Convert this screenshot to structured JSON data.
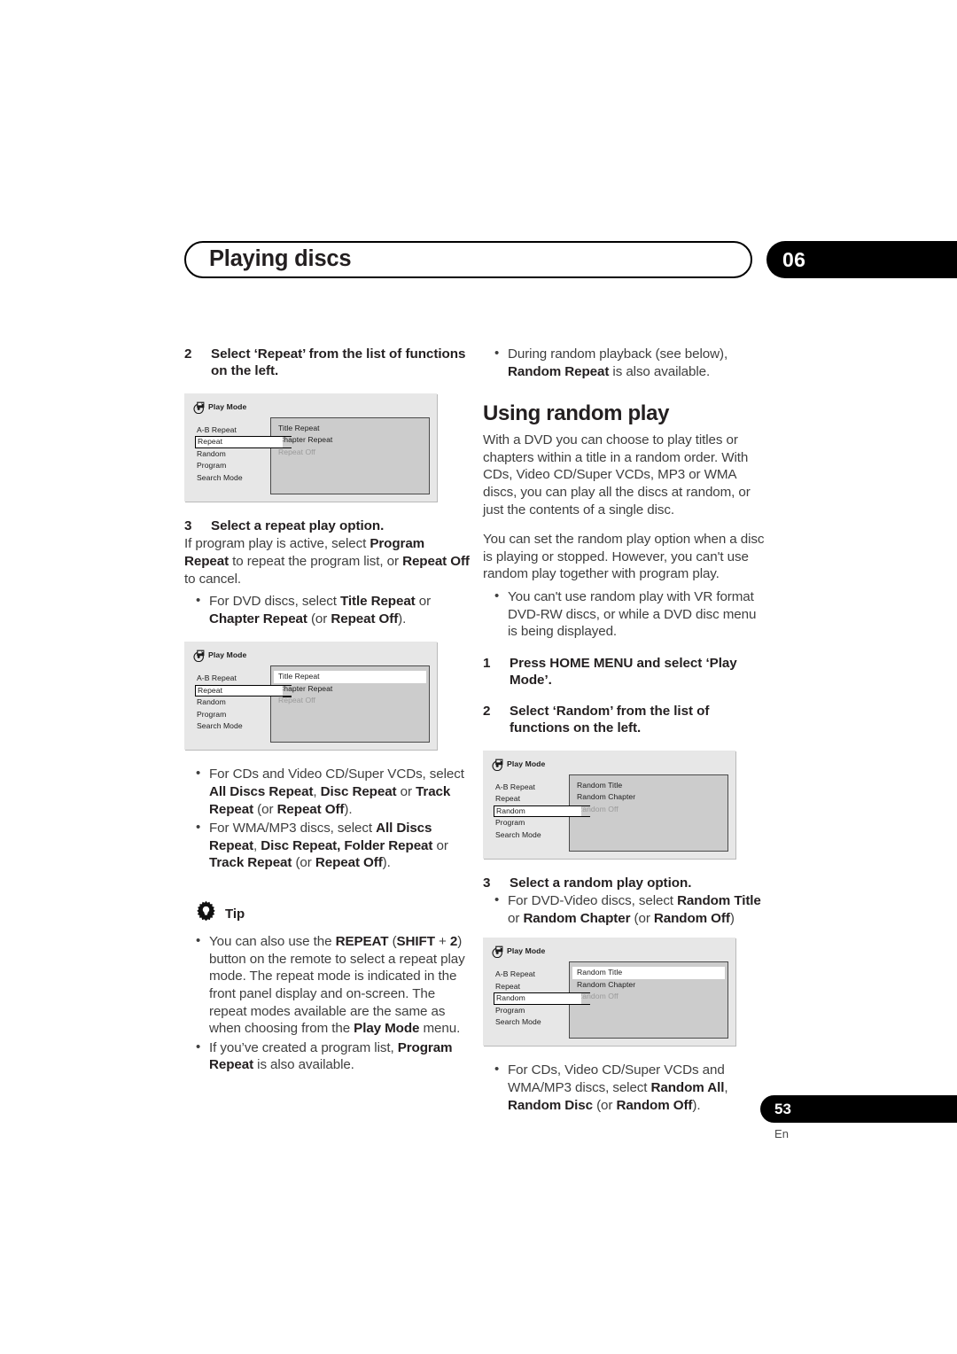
{
  "header": {
    "title": "Playing discs",
    "chapter": "06"
  },
  "footer": {
    "page_number": "53",
    "language": "En"
  },
  "icons": {
    "play_mode": "play-mode-disc-icon",
    "tip": "tip-gear-lightbulb-icon"
  },
  "left_column": {
    "step2": {
      "num": "2",
      "text": "Select ‘Repeat’ from the list of functions on the left."
    },
    "dialog1": {
      "title": "Play Mode",
      "left_items": [
        "A-B Repeat",
        "Repeat",
        "Random",
        "Program",
        "Search Mode"
      ],
      "selected_left": "Repeat",
      "options": [
        {
          "label": "Title Repeat",
          "state": "normal"
        },
        {
          "label": "Chapter Repeat",
          "state": "normal"
        },
        {
          "label": "Repeat Off",
          "state": "dimmed"
        }
      ],
      "highlighted_option": ""
    },
    "step3": {
      "num": "3",
      "text": "Select a repeat play option."
    },
    "step3_body_parts": [
      {
        "t": "If program play is active, select ",
        "b": false
      },
      {
        "t": "Program Repeat",
        "b": true
      },
      {
        "t": " to repeat the program list, or ",
        "b": false
      },
      {
        "t": "Repeat Off",
        "b": true
      },
      {
        "t": " to cancel.",
        "b": false
      }
    ],
    "bullet_dvd_parts": [
      {
        "t": "For DVD discs, select ",
        "b": false
      },
      {
        "t": "Title Repeat",
        "b": true
      },
      {
        "t": " or ",
        "b": false
      },
      {
        "t": "Chapter Repeat",
        "b": true
      },
      {
        "t": " (or ",
        "b": false
      },
      {
        "t": "Repeat Off",
        "b": true
      },
      {
        "t": ").",
        "b": false
      }
    ],
    "dialog2": {
      "title": "Play Mode",
      "left_items": [
        "A-B Repeat",
        "Repeat",
        "Random",
        "Program",
        "Search Mode"
      ],
      "selected_left": "Repeat",
      "options": [
        {
          "label": "Title Repeat",
          "state": "highlighted"
        },
        {
          "label": "Chapter Repeat",
          "state": "normal"
        },
        {
          "label": "Repeat Off",
          "state": "dimmed"
        }
      ],
      "highlighted_option": "Title Repeat"
    },
    "bullet_cd_parts": [
      {
        "t": "For CDs and Video CD/Super VCDs, select ",
        "b": false
      },
      {
        "t": "All Discs Repeat",
        "b": true
      },
      {
        "t": ", ",
        "b": false
      },
      {
        "t": "Disc Repeat",
        "b": true
      },
      {
        "t": " or ",
        "b": false
      },
      {
        "t": "Track Repeat",
        "b": true
      },
      {
        "t": " (or ",
        "b": false
      },
      {
        "t": "Repeat Off",
        "b": true
      },
      {
        "t": ").",
        "b": false
      }
    ],
    "bullet_wma_parts": [
      {
        "t": "For WMA/MP3 discs, select ",
        "b": false
      },
      {
        "t": "All Discs Repeat",
        "b": true
      },
      {
        "t": ", ",
        "b": false
      },
      {
        "t": "Disc Repeat, Folder Repeat",
        "b": true
      },
      {
        "t": " or ",
        "b": false
      },
      {
        "t": "Track Repeat",
        "b": true
      },
      {
        "t": " (or ",
        "b": false
      },
      {
        "t": "Repeat Off",
        "b": true
      },
      {
        "t": ").",
        "b": false
      }
    ],
    "tip": {
      "label": "Tip",
      "bullet1_parts": [
        {
          "t": "You can also use the ",
          "b": false
        },
        {
          "t": "REPEAT",
          "b": true
        },
        {
          "t": " (",
          "b": false
        },
        {
          "t": "SHIFT",
          "b": true
        },
        {
          "t": " + ",
          "b": false
        },
        {
          "t": "2",
          "b": true
        },
        {
          "t": ") button on the remote to select a repeat play mode. The repeat mode is indicated in the front panel display and on-screen. The repeat modes available are the same as when choosing from the ",
          "b": false
        },
        {
          "t": "Play Mode",
          "b": true
        },
        {
          "t": " menu.",
          "b": false
        }
      ],
      "bullet2_parts": [
        {
          "t": "If you’ve created a program list, ",
          "b": false
        },
        {
          "t": "Program Repeat",
          "b": true
        },
        {
          "t": " is also available.",
          "b": false
        }
      ]
    }
  },
  "right_column": {
    "bullet_random_repeat_parts": [
      {
        "t": "During random playback (see below), ",
        "b": false
      },
      {
        "t": "Random Repeat",
        "b": true
      },
      {
        "t": " is also available.",
        "b": false
      }
    ],
    "section_heading": "Using random play",
    "intro_paragraph": "With a DVD you  can choose to play titles or chapters within a title in a random order. With CDs, Video CD/Super VCDs, MP3 or WMA discs, you can play all the discs at random, or just the contents of a single disc.",
    "second_paragraph": "You can set the random play option when a disc is playing or stopped. However, you can't use random play together with program play.",
    "bullet_vr_format": "You can't use random play with VR format DVD-RW discs, or while a DVD disc menu is being displayed.",
    "step1": {
      "num": "1",
      "text": "Press HOME MENU and select ‘Play Mode’."
    },
    "step2": {
      "num": "2",
      "text": "Select ‘Random’ from the list of functions on the left."
    },
    "dialog3": {
      "title": "Play Mode",
      "left_items": [
        "A-B Repeat",
        "Repeat",
        "Random",
        "Program",
        "Search Mode"
      ],
      "selected_left": "Random",
      "options": [
        {
          "label": "Random Title",
          "state": "normal"
        },
        {
          "label": "Random Chapter",
          "state": "normal"
        },
        {
          "label": "Random Off",
          "state": "dimmed"
        }
      ],
      "highlighted_option": ""
    },
    "step3": {
      "num": "3",
      "text": "Select a random play option."
    },
    "bullet_dvd_video_parts": [
      {
        "t": "For DVD-Video discs, select ",
        "b": false
      },
      {
        "t": "Random Title",
        "b": true
      },
      {
        "t": " or ",
        "b": false
      },
      {
        "t": "Random Chapter",
        "b": true
      },
      {
        "t": " (or ",
        "b": false
      },
      {
        "t": "Random Off",
        "b": true
      },
      {
        "t": ")",
        "b": false
      }
    ],
    "dialog4": {
      "title": "Play Mode",
      "left_items": [
        "A-B Repeat",
        "Repeat",
        "Random",
        "Program",
        "Search Mode"
      ],
      "selected_left": "Random",
      "options": [
        {
          "label": "Random Title",
          "state": "highlighted"
        },
        {
          "label": "Random Chapter",
          "state": "normal"
        },
        {
          "label": "Random Off",
          "state": "dimmed"
        }
      ],
      "highlighted_option": "Random Title"
    },
    "bullet_cds_parts": [
      {
        "t": "For CDs, Video CD/Super VCDs and WMA/MP3 discs, select ",
        "b": false
      },
      {
        "t": "Random All",
        "b": true
      },
      {
        "t": ", ",
        "b": false
      },
      {
        "t": "Random Disc",
        "b": true
      },
      {
        "t": " (or ",
        "b": false
      },
      {
        "t": "Random Off",
        "b": true
      },
      {
        "t": ").",
        "b": false
      }
    ]
  }
}
